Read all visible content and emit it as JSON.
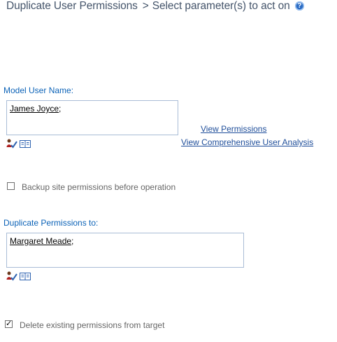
{
  "header": {
    "title": "Duplicate User Permissions",
    "separator": ">",
    "subtitle": "Select parameter(s) to act on",
    "help_glyph": "?"
  },
  "model_user": {
    "label": "Model User Name:",
    "value": "James Joyce",
    "value_suffix": ";",
    "check_names_icon": "check-names-icon",
    "browse_icon": "address-book-icon"
  },
  "links": {
    "view_permissions": "View Permissions",
    "view_analysis": "View Comprehensive User Analysis"
  },
  "backup": {
    "label": "Backup site permissions before operation",
    "checked": false
  },
  "target": {
    "label": "Duplicate Permissions to:",
    "value": "Margaret Meade",
    "value_suffix": ";",
    "check_names_icon": "check-names-icon",
    "browse_icon": "address-book-icon"
  },
  "delete_existing": {
    "label": "Delete existing permissions from target",
    "checked": true,
    "check_glyph": "✓"
  }
}
